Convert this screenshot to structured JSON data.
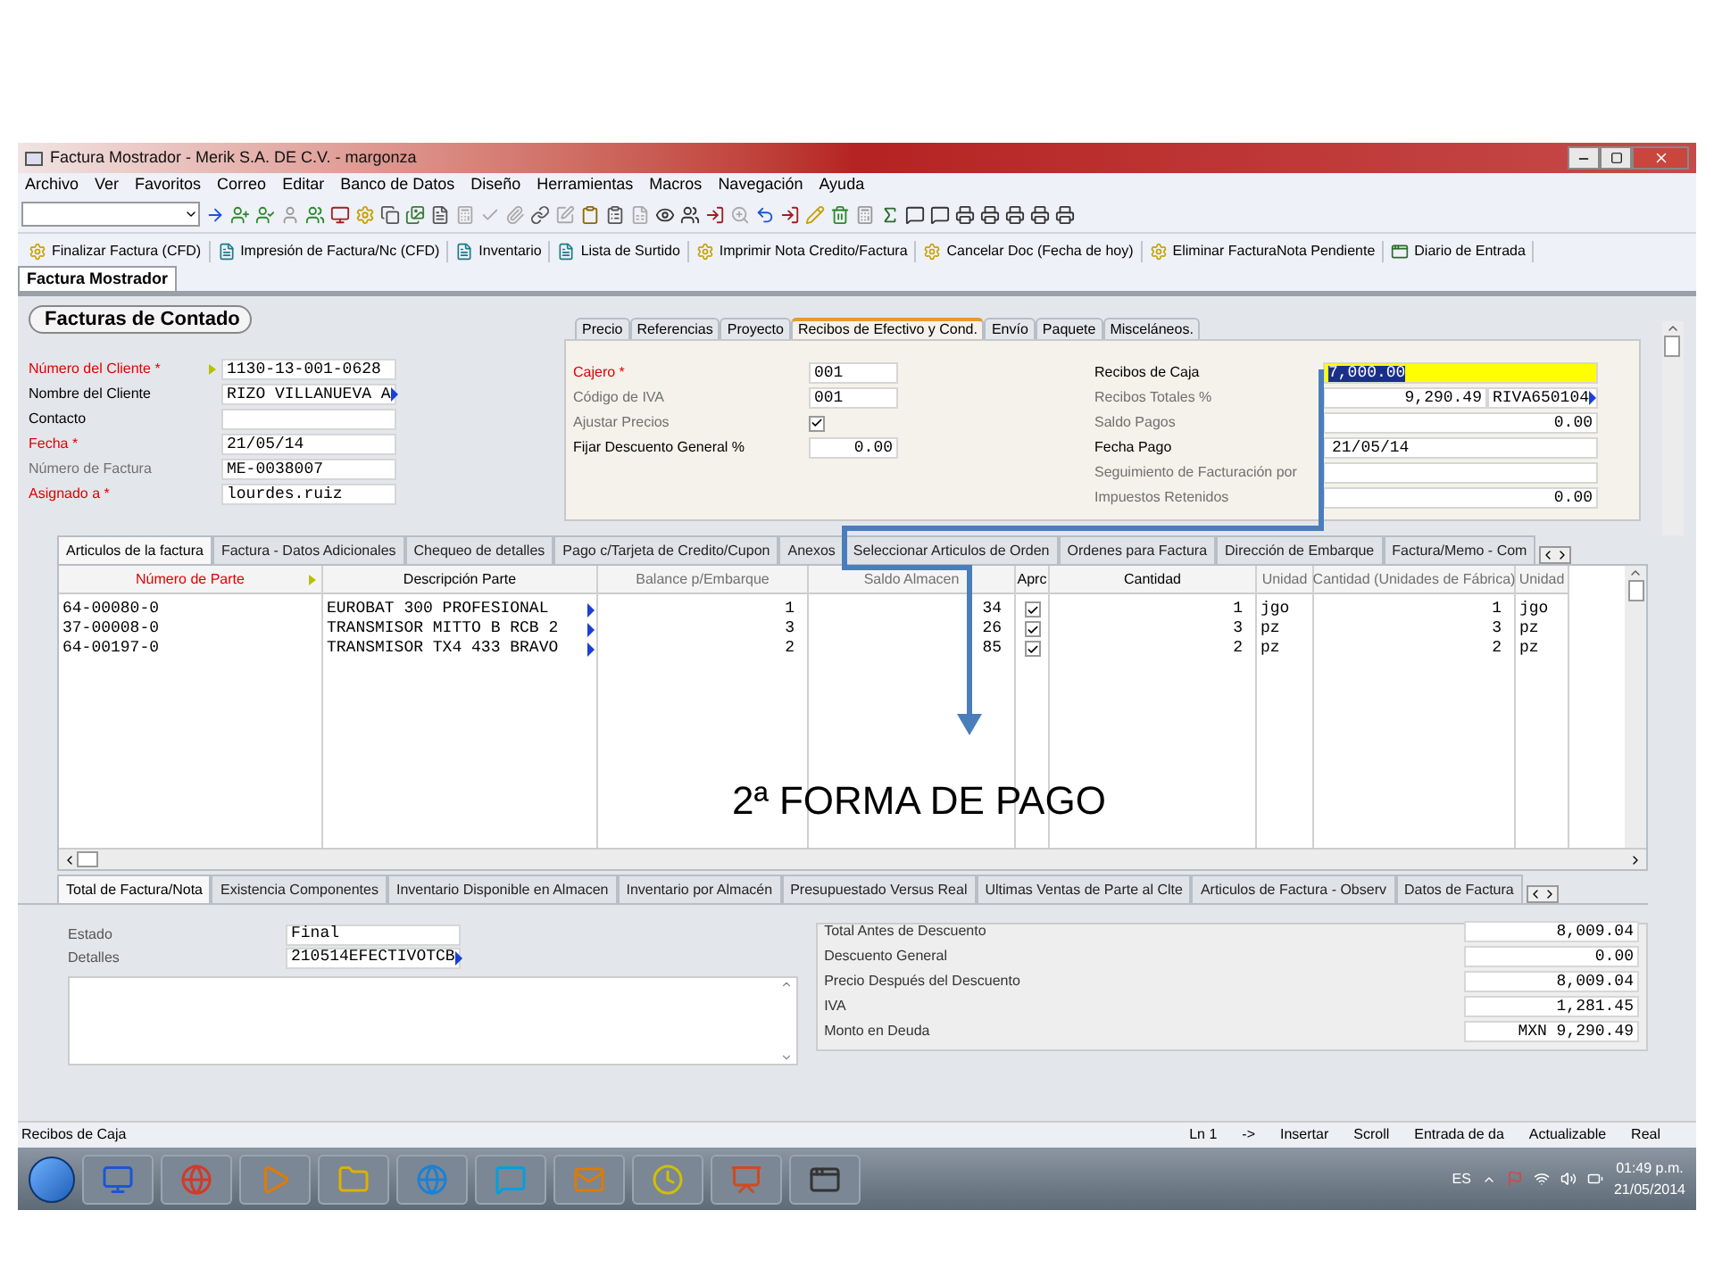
{
  "window": {
    "title": "Factura Mostrador - Merik S.A. DE C.V. - margonza"
  },
  "menu": [
    "Archivo",
    "Ver",
    "Favoritos",
    "Correo",
    "Editar",
    "Banco de Datos",
    "Diseño",
    "Herramientas",
    "Macros",
    "Navegación",
    "Ayuda"
  ],
  "commands": [
    "Finalizar Factura (CFD)",
    "Impresión de Factura/Nc (CFD)",
    "Inventario",
    "Lista de Surtido",
    "Imprimir Nota Credito/Factura",
    "Cancelar Doc (Fecha de hoy)",
    "Eliminar FacturaNota Pendiente",
    "Diario de Entrada"
  ],
  "doc_tabs": [
    {
      "label": "Factura Mostrador",
      "selected": true
    }
  ],
  "form": {
    "title": "Facturas de Contado",
    "fields": [
      {
        "label": "Número del Cliente *",
        "required": true,
        "readonly": false,
        "value": "1130-13-001-0628",
        "lookup": true,
        "overflow": false
      },
      {
        "label": "Nombre del Cliente",
        "required": false,
        "readonly": false,
        "value": "RIZO VILLANUEVA A",
        "lookup": false,
        "overflow": true
      },
      {
        "label": "Contacto",
        "required": false,
        "readonly": false,
        "lookup": false,
        "overflow": false
      },
      {
        "label": "Fecha *",
        "required": true,
        "readonly": false,
        "value": "21/05/14",
        "lookup": false,
        "overflow": false
      },
      {
        "label": "Número de Factura",
        "required": false,
        "readonly": true,
        "value": "ME-0038007",
        "lookup": false,
        "overflow": false
      },
      {
        "label": "Asignado a *",
        "required": true,
        "readonly": false,
        "value": "lourdes.ruiz",
        "lookup": false,
        "overflow": false
      }
    ]
  },
  "detail_tabs": [
    {
      "label": "Precio",
      "selected": false
    },
    {
      "label": "Referencias",
      "selected": false
    },
    {
      "label": "Proyecto",
      "selected": false
    },
    {
      "label": "Recibos de Efectivo y Cond.",
      "selected": true
    },
    {
      "label": "Envío",
      "selected": false
    },
    {
      "label": "Paquete",
      "selected": false
    },
    {
      "label": "Misceláneos.",
      "selected": false
    }
  ],
  "detail_left": [
    {
      "label": "Cajero *",
      "required": true,
      "readonly": false,
      "kind": "text",
      "value": "001"
    },
    {
      "label": "Código de IVA",
      "required": false,
      "readonly": true,
      "kind": "text",
      "value": "001"
    },
    {
      "label": "Ajustar Precios",
      "required": false,
      "readonly": true,
      "kind": "check",
      "checked": true
    },
    {
      "label": "Fijar Descuento General %",
      "required": false,
      "readonly": false,
      "kind": "number",
      "value": "0.00"
    }
  ],
  "detail_right": [
    {
      "label": "Recibos de Caja",
      "required": false,
      "readonly": false,
      "kind": "highlight",
      "value": "7,000.00"
    },
    {
      "label": "Recibos Totales %",
      "required": false,
      "readonly": true,
      "kind": "number",
      "value": "9,290.49",
      "extra": "RIVA650104"
    },
    {
      "label": "Saldo Pagos",
      "required": false,
      "readonly": true,
      "kind": "number",
      "value": "0.00"
    },
    {
      "label": "Fecha Pago",
      "required": false,
      "readonly": false,
      "kind": "text",
      "value": "21/05/14"
    },
    {
      "label": "Seguimiento de Facturación por",
      "required": false,
      "readonly": true,
      "kind": "text"
    },
    {
      "label": "Impuestos Retenidos",
      "required": false,
      "readonly": true,
      "kind": "number",
      "value": "0.00"
    }
  ],
  "main_tabs": [
    {
      "label": "Articulos de la factura",
      "selected": true
    },
    {
      "label": "Factura - Datos Adicionales",
      "selected": false
    },
    {
      "label": "Chequeo de detalles",
      "selected": false
    },
    {
      "label": "Pago c/Tarjeta de Credito/Cupon",
      "selected": false
    },
    {
      "label": "Anexos",
      "selected": false
    },
    {
      "label": "Seleccionar Articulos de Orden",
      "selected": false
    },
    {
      "label": "Ordenes para Factura",
      "selected": false
    },
    {
      "label": "Dirección de Embarque",
      "selected": false
    },
    {
      "label": "Factura/Memo - Com",
      "selected": false
    }
  ],
  "table": {
    "columns": [
      {
        "label": "Número de Parte",
        "required": true,
        "readonly": false,
        "lookup": true,
        "overflow": false
      },
      {
        "label": "Descripción Parte",
        "required": false,
        "readonly": false,
        "lookup": false,
        "overflow": true
      },
      {
        "label": "Balance p/Embarque",
        "required": false,
        "readonly": true,
        "lookup": false,
        "overflow": false
      },
      {
        "label": "Saldo Almacen",
        "required": false,
        "readonly": true,
        "lookup": false,
        "overflow": false
      },
      {
        "label": "Aprc",
        "required": false,
        "readonly": false,
        "lookup": false,
        "overflow": false
      },
      {
        "label": "Cantidad",
        "required": false,
        "readonly": false,
        "lookup": false,
        "overflow": false
      },
      {
        "label": "Unidad",
        "required": false,
        "readonly": true,
        "lookup": false,
        "overflow": false
      },
      {
        "label": "Cantidad (Unidades de Fábrica)",
        "required": false,
        "readonly": true,
        "lookup": false,
        "overflow": false
      },
      {
        "label": "Unidad",
        "required": false,
        "readonly": true,
        "lookup": false,
        "overflow": false
      }
    ],
    "rows": [
      {
        "cells": [
          "64-00080-0",
          "EUROBAT 300 PROFESIONAL",
          "1",
          "34",
          "",
          "1",
          "jgo",
          "1",
          "jgo"
        ],
        "approved": true
      },
      {
        "cells": [
          "37-00008-0",
          "TRANSMISOR MITTO B RCB 2",
          "3",
          "26",
          "",
          "3",
          "pz",
          "3",
          "pz"
        ],
        "approved": true
      },
      {
        "cells": [
          "64-00197-0",
          "TRANSMISOR TX4 433 BRAVO",
          "2",
          "85",
          "",
          "2",
          "pz",
          "2",
          "pz"
        ],
        "approved": true
      }
    ]
  },
  "annotation": {
    "text": "2ª FORMA DE PAGO"
  },
  "bottom_tabs": [
    {
      "label": "Total de Factura/Nota",
      "selected": true
    },
    {
      "label": "Existencia Componentes",
      "selected": false
    },
    {
      "label": "Inventario Disponible en Almacen",
      "selected": false
    },
    {
      "label": "Inventario por Almacén",
      "selected": false
    },
    {
      "label": "Presupuestado Versus Real",
      "selected": false
    },
    {
      "label": "Ultimas Ventas de Parte al Clte",
      "selected": false
    },
    {
      "label": "Articulos de Factura - Observ",
      "selected": false
    },
    {
      "label": "Datos de Factura",
      "selected": false
    }
  ],
  "status_fields": [
    {
      "label": "Estado",
      "value": "Final",
      "overflow": false
    },
    {
      "label": "Detalles",
      "value": "210514EFECTIVOTCB",
      "overflow": true
    }
  ],
  "totals": [
    {
      "label": "Total Antes de Descuento",
      "value": "8,009.04"
    },
    {
      "label": "Descuento General",
      "value": "0.00"
    },
    {
      "label": "Precio Después del Descuento",
      "value": "8,009.04"
    },
    {
      "label": "IVA",
      "value": "1,281.45"
    },
    {
      "label": "Monto en Deuda",
      "value": "MXN 9,290.49"
    }
  ],
  "status_bar": {
    "left": "Recibos de Caja",
    "items": [
      "Ln 1",
      "->",
      "Insertar",
      "Scroll",
      "Entrada de da",
      "Actualizable",
      "Real"
    ]
  },
  "taskbar": {
    "language": "ES",
    "time": "01:49 p.m.",
    "date": "21/05/2014"
  }
}
